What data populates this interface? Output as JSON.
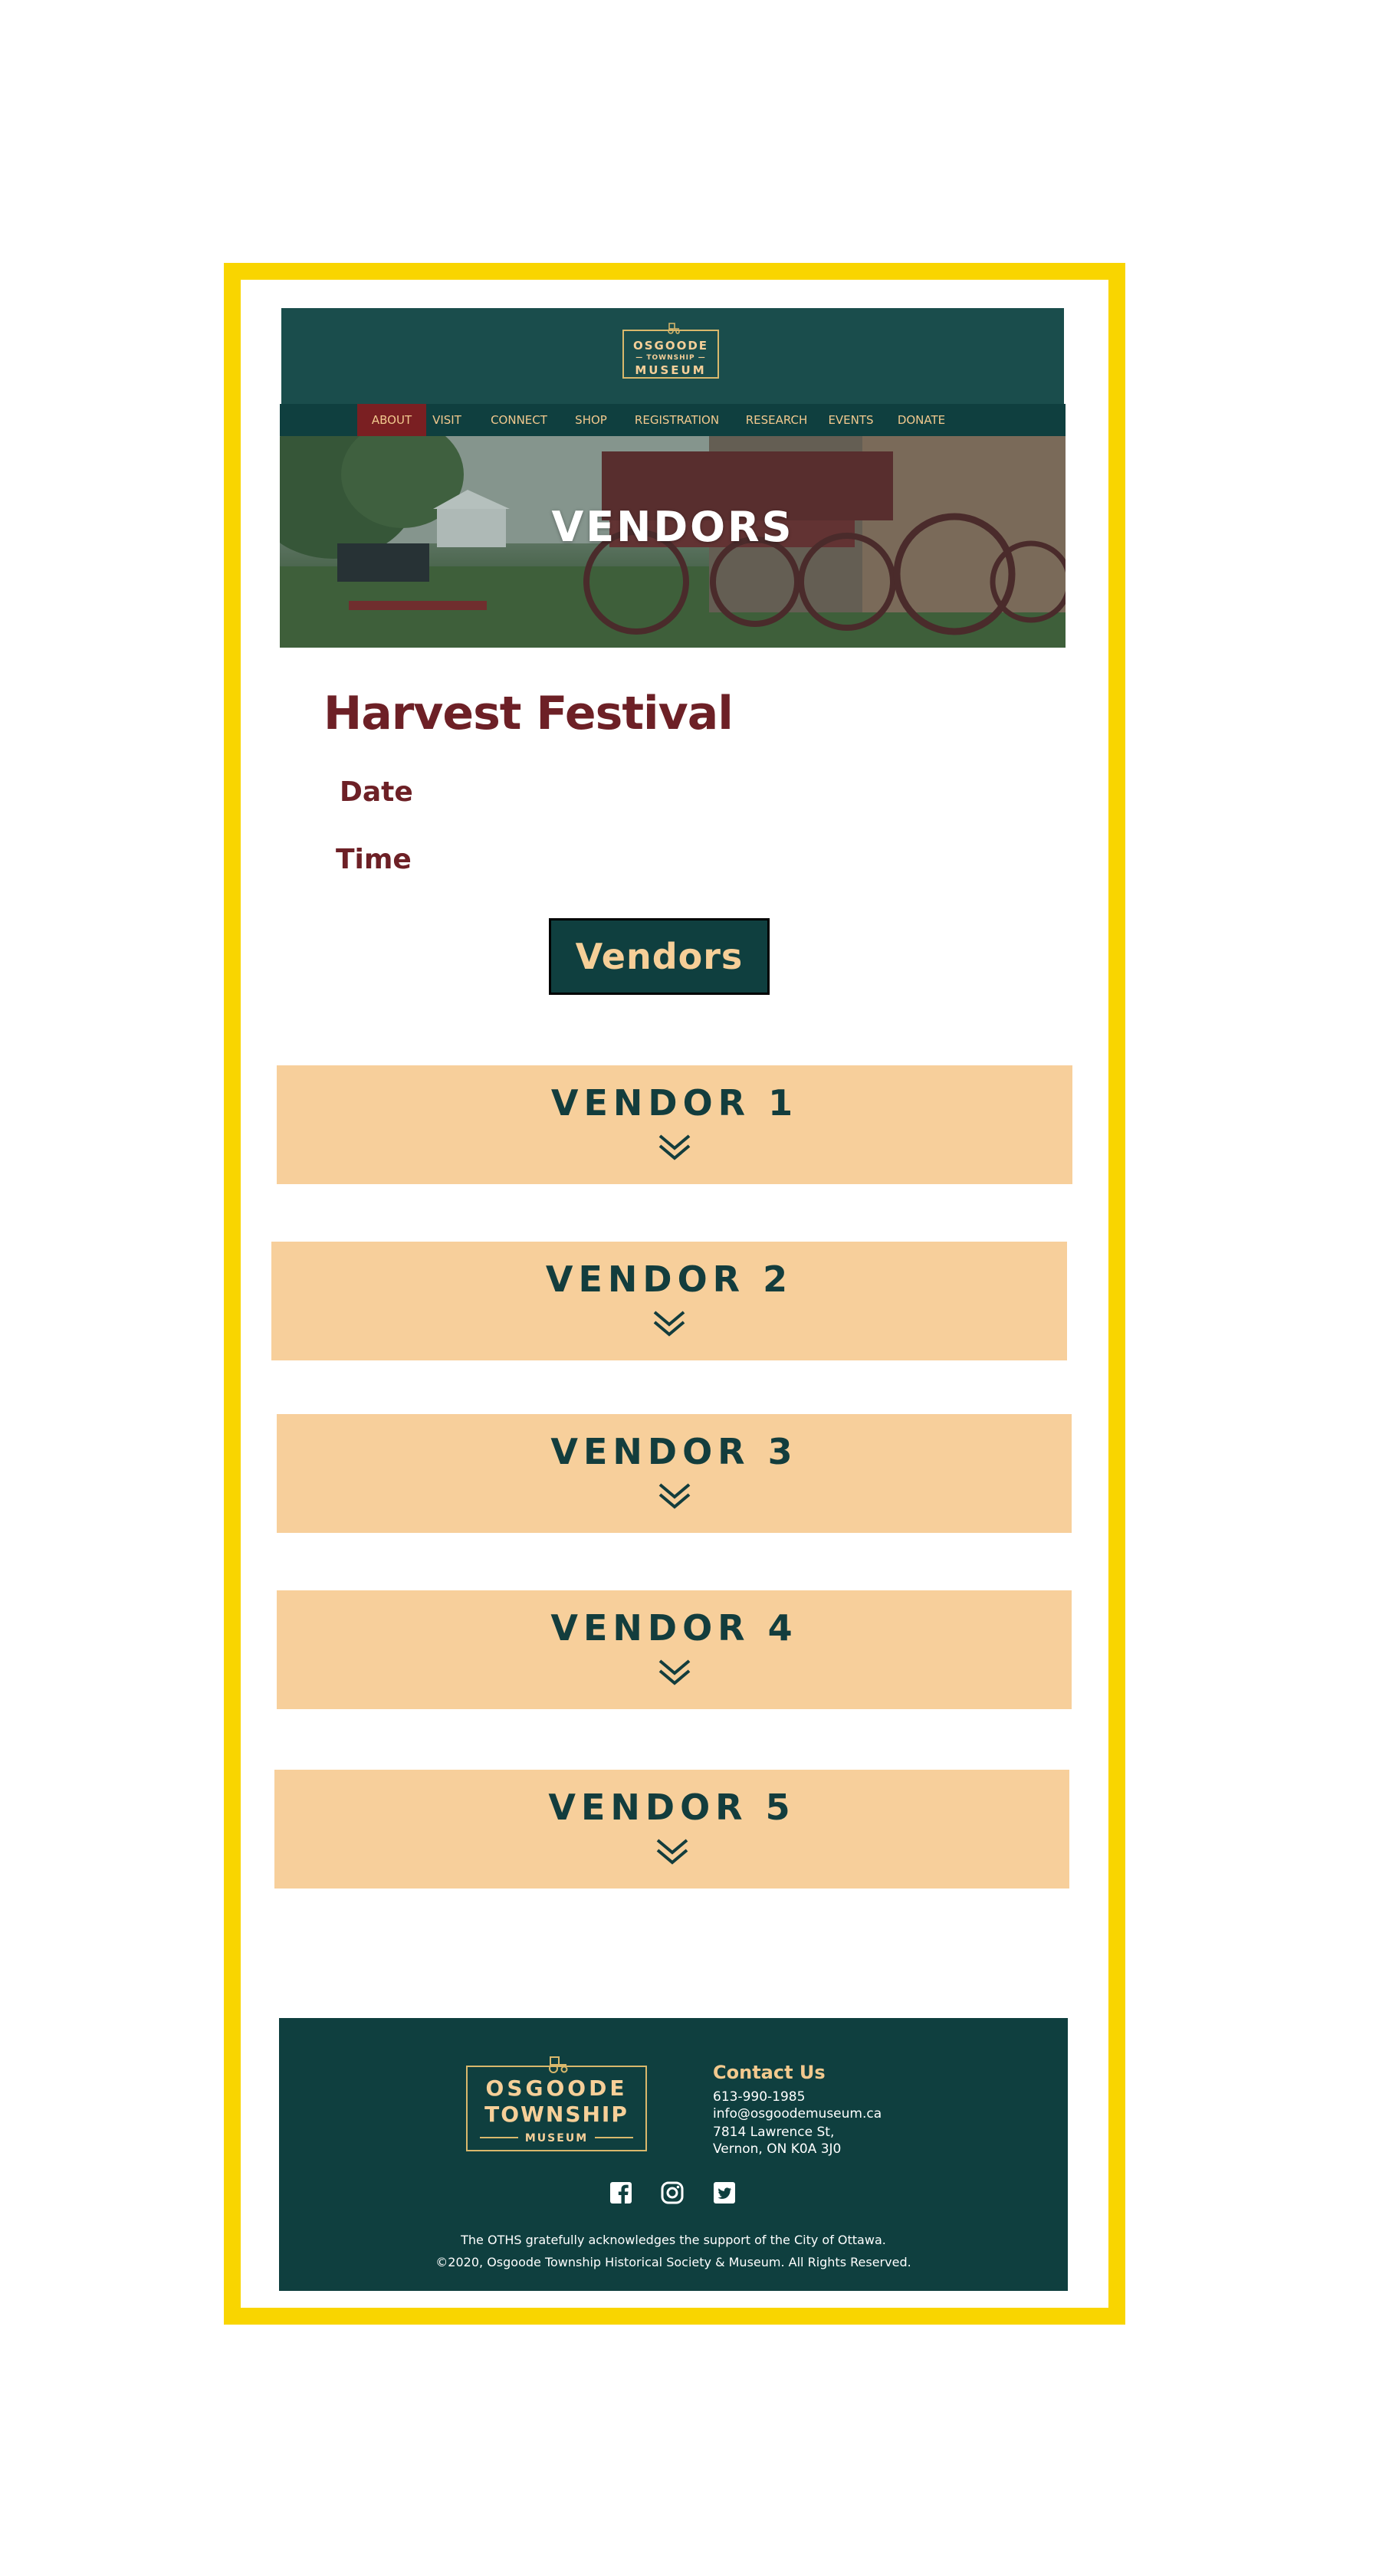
{
  "header": {
    "logo": {
      "line1": "OSGOODE",
      "line2": "— TOWNSHIP —",
      "line3": "MUSEUM"
    }
  },
  "nav": {
    "items": [
      {
        "label": "ABOUT",
        "active": true
      },
      {
        "label": "VISIT",
        "active": false
      },
      {
        "label": "CONNECT",
        "active": false
      },
      {
        "label": "SHOP",
        "active": false
      },
      {
        "label": "REGISTRATION",
        "active": false
      },
      {
        "label": "RESEARCH",
        "active": false
      },
      {
        "label": "EVENTS",
        "active": false
      },
      {
        "label": "DONATE",
        "active": false
      }
    ]
  },
  "hero": {
    "title": "VENDORS"
  },
  "event": {
    "title": "Harvest Festival",
    "date_label": "Date",
    "time_label": "Time",
    "vendors_button": "Vendors"
  },
  "vendors": [
    {
      "label": "VENDOR 1"
    },
    {
      "label": "VENDOR 2"
    },
    {
      "label": "VENDOR 3"
    },
    {
      "label": "VENDOR 4"
    },
    {
      "label": "VENDOR 5"
    }
  ],
  "footer": {
    "logo": {
      "line1": "OSGOODE",
      "line2": "TOWNSHIP",
      "line3": "MUSEUM"
    },
    "contact_title": "Contact Us",
    "phone": "613-990-1985",
    "email": "info@osgoodemuseum.ca",
    "address_line1": "7814 Lawrence St,",
    "address_line2": "Vernon, ON K0A 3J0",
    "social": [
      "facebook-icon",
      "instagram-icon",
      "twitter-icon"
    ],
    "acknowledgement": "The OTHS gratefully acknowledges the support of the City of Ottawa.",
    "copyright": "©2020, Osgoode Township Historical Society & Museum. All Rights Reserved."
  },
  "colors": {
    "frame": "#f9d500",
    "header": "#1a4d4c",
    "nav": "#0f3f3f",
    "nav_active": "#7a1f22",
    "accent_text": "#6d2026",
    "vendor_panel": "#f7cf9b",
    "gold": "#f6cf98"
  }
}
